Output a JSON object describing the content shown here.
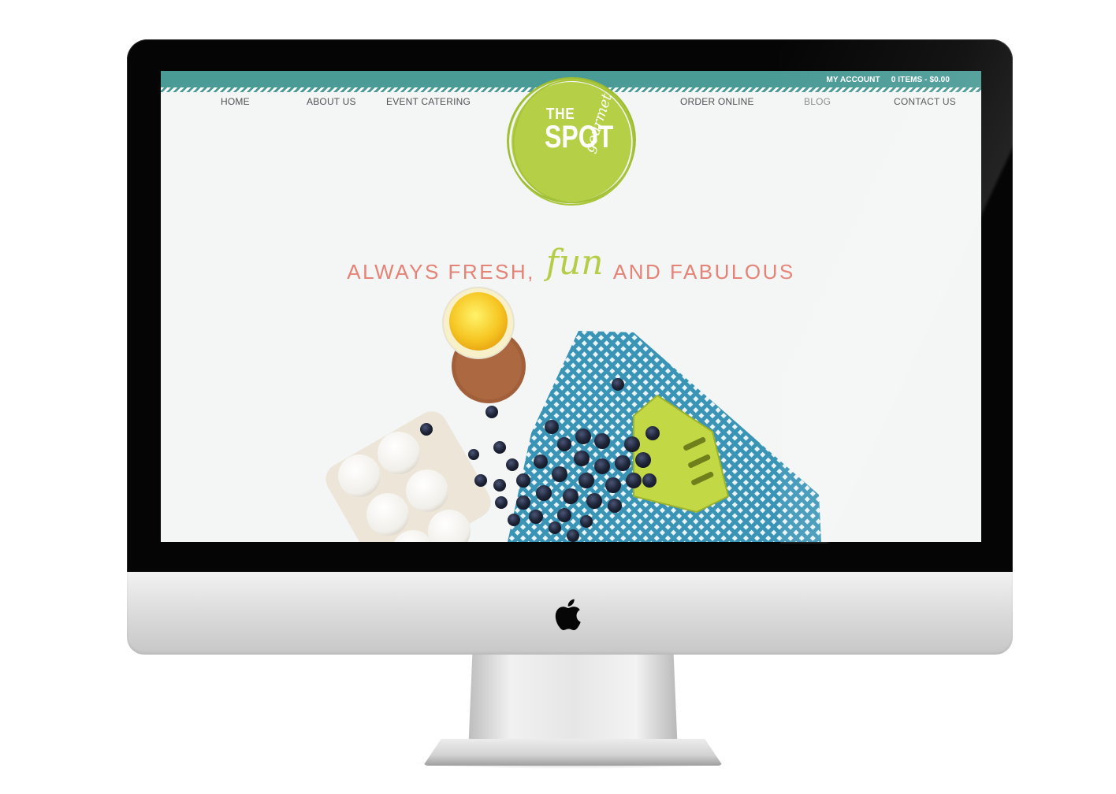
{
  "topbar": {
    "account_label": "MY ACCOUNT",
    "cart_label": "0 ITEMS - $0.00"
  },
  "nav": {
    "items": [
      {
        "label": "HOME"
      },
      {
        "label": "ABOUT US"
      },
      {
        "label": "EVENT CATERING"
      },
      {
        "label": "ORDER ONLINE"
      },
      {
        "label": "BLOG"
      },
      {
        "label": "CONTACT US"
      }
    ]
  },
  "logo": {
    "line1": "THE",
    "line2": "SPOT",
    "line3": "gourmet"
  },
  "hero": {
    "tagline_start": "ALWAYS FRESH,",
    "tagline_script": "fun",
    "tagline_end": "AND FABULOUS"
  },
  "colors": {
    "topbar": "#4a9a96",
    "logo_green": "#b5cf47",
    "tagline": "#e48376",
    "nav_text": "#505355"
  },
  "icons": {
    "monitor_logo": "apple-icon"
  }
}
